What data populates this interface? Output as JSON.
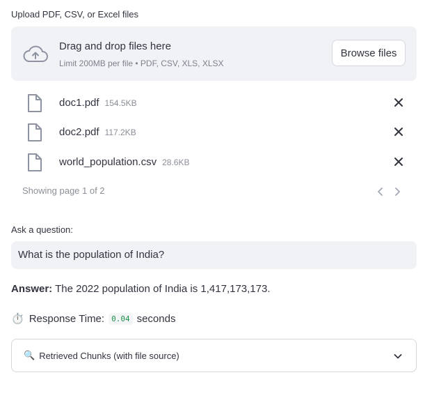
{
  "uploader": {
    "label": "Upload PDF, CSV, or Excel files",
    "dropzone_title": "Drag and drop files here",
    "dropzone_limit": "Limit 200MB per file • PDF, CSV, XLS, XLSX",
    "browse_label": "Browse files",
    "icon": "cloud-upload-icon"
  },
  "files": [
    {
      "name": "doc1.pdf",
      "size": "154.5KB"
    },
    {
      "name": "doc2.pdf",
      "size": "117.2KB"
    },
    {
      "name": "world_population.csv",
      "size": "28.6KB"
    }
  ],
  "pagination": {
    "text": "Showing page 1 of 2"
  },
  "question": {
    "label": "Ask a question:",
    "value": "What is the population of India?"
  },
  "answer": {
    "prefix": "Answer:",
    "text": " The 2022 population of India is 1,417,173,173."
  },
  "response_time": {
    "icon": "⏱️",
    "label": "Response Time:",
    "value": "0.04",
    "unit": "seconds"
  },
  "expander": {
    "icon": "🔍",
    "label": "Retrieved Chunks (with file source)"
  },
  "colors": {
    "panel_bg": "#f0f2f6",
    "code_green": "#1f8f4e",
    "muted": "#8a8e97"
  }
}
